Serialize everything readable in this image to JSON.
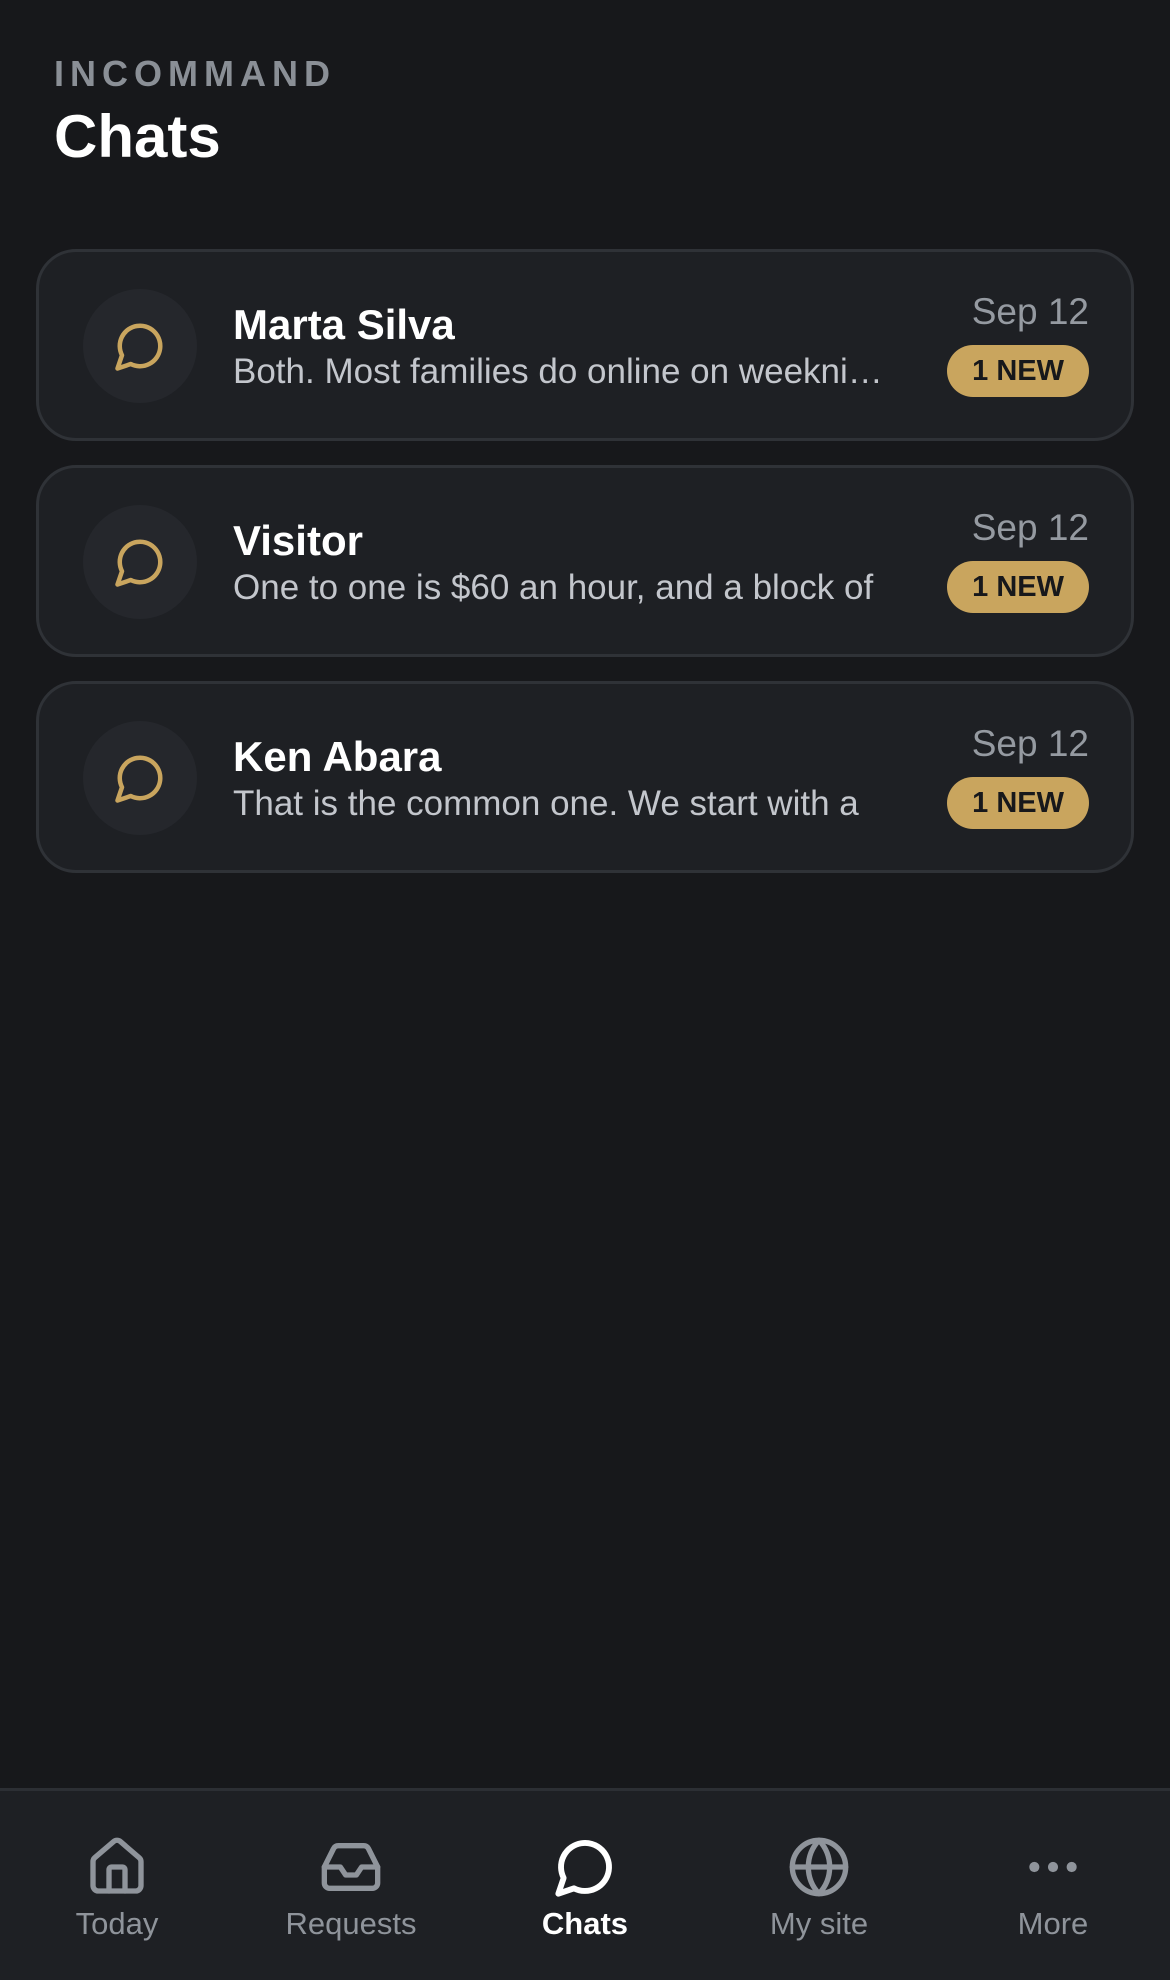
{
  "header": {
    "brand": "INCOMMAND",
    "title": "Chats"
  },
  "colors": {
    "background": "#17181b",
    "card": "#1e2024",
    "accent_gold": "#c9a55e",
    "muted_text": "#8f949b"
  },
  "chats": [
    {
      "name": "Marta Silva",
      "preview": "Both. Most families do online on weeknights",
      "date": "Sep 12",
      "badge": "1 NEW",
      "icon": "chat-bubble-icon"
    },
    {
      "name": "Visitor",
      "preview": "One to one is $60 an hour, and a block of",
      "date": "Sep 12",
      "badge": "1 NEW",
      "icon": "chat-bubble-icon"
    },
    {
      "name": "Ken Abara",
      "preview": "That is the common one. We start with a",
      "date": "Sep 12",
      "badge": "1 NEW",
      "icon": "chat-bubble-icon"
    }
  ],
  "tabbar": {
    "tabs": [
      {
        "label": "Today",
        "icon": "home-icon",
        "active": false
      },
      {
        "label": "Requests",
        "icon": "inbox-icon",
        "active": false
      },
      {
        "label": "Chats",
        "icon": "chat-bubble-icon",
        "active": true
      },
      {
        "label": "My site",
        "icon": "globe-icon",
        "active": false
      },
      {
        "label": "More",
        "icon": "more-dots-icon",
        "active": false
      }
    ]
  }
}
